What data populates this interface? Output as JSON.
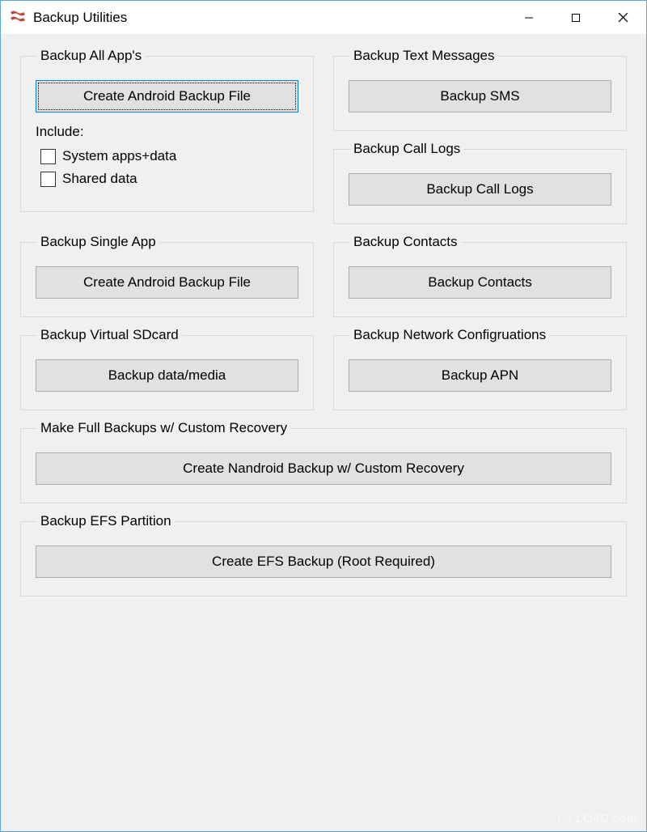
{
  "window": {
    "title": "Backup Utilities"
  },
  "groups": {
    "backup_all_apps": {
      "legend": "Backup All App's",
      "button": "Create Android Backup File",
      "include_label": "Include:",
      "checkbox_system": "System apps+data",
      "checkbox_shared": "Shared data"
    },
    "backup_text_messages": {
      "legend": "Backup Text Messages",
      "button": "Backup SMS"
    },
    "backup_call_logs": {
      "legend": "Backup Call Logs",
      "button": "Backup Call Logs"
    },
    "backup_single_app": {
      "legend": "Backup Single App",
      "button": "Create Android Backup File"
    },
    "backup_contacts": {
      "legend": "Backup Contacts",
      "button": "Backup Contacts"
    },
    "backup_virtual_sdcard": {
      "legend": "Backup Virtual SDcard",
      "button": "Backup data/media"
    },
    "backup_network": {
      "legend": "Backup Network Configruations",
      "button": "Backup APN"
    },
    "full_backups": {
      "legend": "Make Full Backups w/ Custom Recovery",
      "button": "Create Nandroid Backup w/ Custom Recovery"
    },
    "backup_efs": {
      "legend": "Backup EFS Partition",
      "button": "Create EFS Backup (Root Required)"
    }
  },
  "watermark": "LO4D.com"
}
